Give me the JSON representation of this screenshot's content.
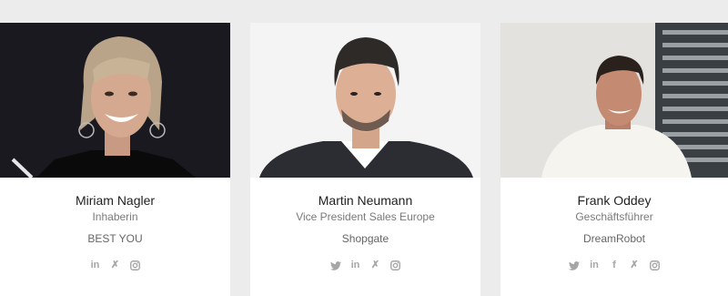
{
  "cards": [
    {
      "name": "Miriam Nagler",
      "role": "Inhaberin",
      "company": "BEST YOU",
      "socials": [
        "linkedin-icon",
        "xing-icon",
        "instagram-icon"
      ]
    },
    {
      "name": "Martin Neumann",
      "role": "Vice President Sales Europe",
      "company": "Shopgate",
      "socials": [
        "twitter-icon",
        "linkedin-icon",
        "xing-icon",
        "instagram-icon"
      ]
    },
    {
      "name": "Frank Oddey",
      "role": "Geschäftsführer",
      "company": "DreamRobot",
      "socials": [
        "twitter-icon",
        "linkedin-icon",
        "facebook-icon",
        "xing-icon",
        "instagram-icon"
      ]
    }
  ],
  "social_glyphs": {
    "linkedin": "in",
    "xing": "✗",
    "facebook": "f"
  },
  "colors": {
    "page_background": "#ececec",
    "card_background": "#ffffff",
    "name_text": "#1f1f1f",
    "subtitle_text": "#7a7a7a",
    "icon_color": "#a6a6a6"
  }
}
